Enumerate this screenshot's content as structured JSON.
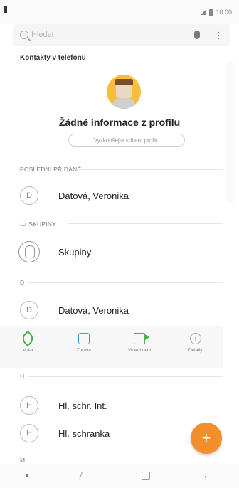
{
  "status_bar": {
    "time": "10:00"
  },
  "search": {
    "placeholder": "Hledat"
  },
  "section": {
    "title": "Kontakty v telefonu"
  },
  "profile": {
    "title": "Žádné informace z profilu",
    "share_label": "Vyzkoušejte sdílení profilu"
  },
  "recent": {
    "header": "POSLEDNÍ PŘIDANÉ",
    "contacts": [
      {
        "initial": "D",
        "name": "Datová, Veronika"
      }
    ]
  },
  "groups": {
    "header": "SKUPINY",
    "label": "Skupiny"
  },
  "section_d": {
    "letter": "D",
    "contacts": [
      {
        "initial": "D",
        "name": "Datová, Veronika"
      }
    ]
  },
  "actions": [
    {
      "label": "Volat",
      "icon": "phone-icon"
    },
    {
      "label": "Zpráva",
      "icon": "message-icon"
    },
    {
      "label": "Videohovor",
      "icon": "video-call-icon"
    },
    {
      "label": "Detaily",
      "icon": "info-icon"
    }
  ],
  "section_h": {
    "letter": "H",
    "contacts": [
      {
        "initial": "H",
        "name": "Hl. schr. Int."
      },
      {
        "initial": "H",
        "name": "Hl. schranka"
      }
    ]
  },
  "section_m": {
    "letter": "M"
  },
  "fab": {
    "label": "+"
  },
  "colors": {
    "accent": "#f28e2b",
    "call": "#4caf50",
    "message": "#3aa0d8"
  }
}
